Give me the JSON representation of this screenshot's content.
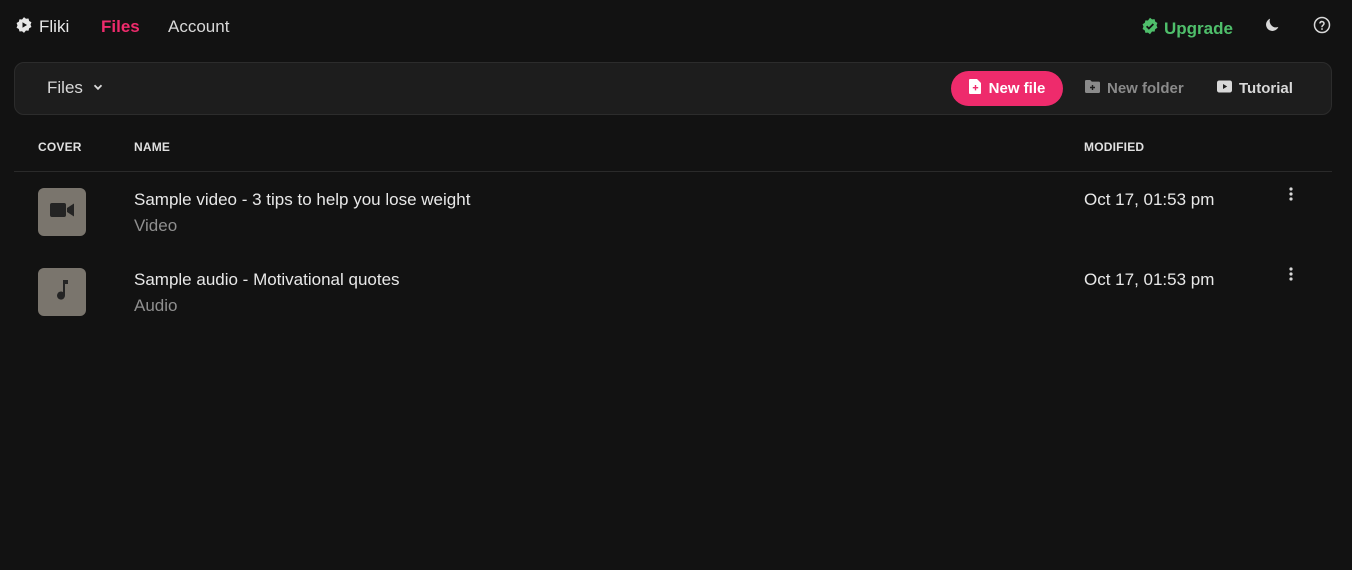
{
  "nav": {
    "brand": "Fliki",
    "links": [
      "Files",
      "Account"
    ],
    "upgrade": "Upgrade",
    "icons": [
      "fliki-logo-icon",
      "verified-badge-icon",
      "moon-icon",
      "help-circle-icon"
    ]
  },
  "toolbar": {
    "folder_selector": "Files",
    "new_file": "New file",
    "new_folder": "New folder",
    "tutorial": "Tutorial",
    "icons": [
      "chevron-down-icon",
      "file-icon",
      "folder-plus-icon",
      "youtube-icon"
    ]
  },
  "table": {
    "columns": [
      "COVER",
      "NAME",
      "MODIFIED"
    ],
    "rows": [
      {
        "name": "Sample video - 3 tips to help you lose weight",
        "type": "Video",
        "modified": "Oct 17, 01:53 pm",
        "icon": "video-camera-icon"
      },
      {
        "name": "Sample audio - Motivational quotes",
        "type": "Audio",
        "modified": "Oct 17, 01:53 pm",
        "icon": "music-note-icon"
      }
    ]
  },
  "colors": {
    "accent": "#ee2b6c",
    "upgrade": "#4fbf6b",
    "background": "#121212",
    "toolbar": "#1d1d1d",
    "thumb": "#7a756d"
  }
}
